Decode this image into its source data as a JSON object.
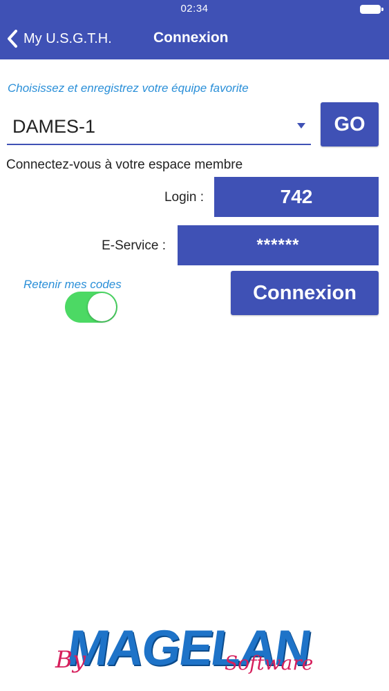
{
  "status_bar": {
    "time": "02:34"
  },
  "nav": {
    "back_label": "My U.S.G.T.H.",
    "title": "Connexion"
  },
  "team_hint": "Choisissez et enregistrez votre équipe favorite",
  "team_select": {
    "value": "DAMES-1"
  },
  "go_label": "GO",
  "member_text": "Connectez-vous à votre espace membre",
  "login": {
    "label": "Login :",
    "value": "742"
  },
  "eservice": {
    "label": "E-Service :",
    "value": "******"
  },
  "remember": {
    "label": "Retenir mes codes",
    "on": true
  },
  "connect_label": "Connexion",
  "logo": {
    "by": "By",
    "name": "MAGELAN",
    "software": "Software"
  },
  "colors": {
    "primary": "#3f51b5",
    "hint": "#2a8fd8",
    "toggle_on": "#4cd964",
    "logo_blue": "#1e73c8",
    "logo_pink": "#d61f5c"
  },
  "icons": {
    "back": "chevron-left-icon",
    "dropdown": "caret-down-icon",
    "battery": "battery-icon"
  }
}
